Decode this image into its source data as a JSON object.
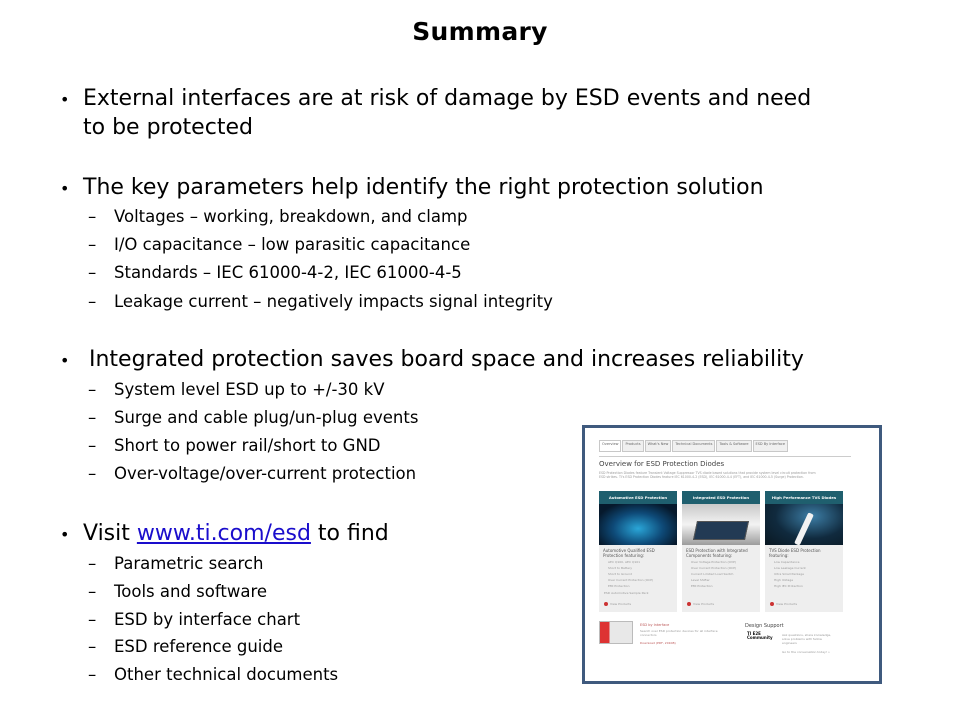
{
  "slide": {
    "title": "Summary",
    "bullets": [
      {
        "lines": [
          "External interfaces are at risk of damage by ESD events and need",
          "to be protected"
        ],
        "sub": []
      },
      {
        "lines": [
          "The key parameters help identify the right protection solution"
        ],
        "sub": [
          "Voltages – working, breakdown, and clamp",
          "I/O capacitance – low parasitic capacitance",
          "Standards – IEC 61000-4-2, IEC 61000-4-5",
          "Leakage current – negatively impacts signal integrity"
        ]
      },
      {
        "lines": [
          "Integrated protection saves board space and increases reliability"
        ],
        "sub": [
          "System level ESD up to +/-30 kV",
          "Surge and cable plug/un-plug events",
          "Short to power rail/short to GND",
          "Over-voltage/over-current protection"
        ]
      },
      {
        "prefix": "Visit ",
        "link": "www.ti.com/esd",
        "suffix": " to find",
        "sub": [
          "Parametric search",
          "Tools and software",
          "ESD by interface chart",
          "ESD reference guide",
          "Other technical documents"
        ]
      }
    ],
    "bullet_glyph": "•",
    "dash_glyph": "–"
  },
  "embedded_screenshot": {
    "tabs": [
      "Overview",
      "Products",
      "What's New",
      "Technical Documents",
      "Tools & Software",
      "ESD By Interface"
    ],
    "title": "Overview for ESD Protection Diodes",
    "description": "ESD Protection Diodes feature Transient Voltage Suppressor TVS diode based solutions that provide system level circuit protection from ESD strikes. TI's ESD Protection Diodes feature IEC 61000-4-2 (ESD), IEC 61000-4-4 (EFT), and IEC 61000-4-5 (Surge) Protection.",
    "cards": [
      {
        "header": "Automotive ESD Protection",
        "title": "Automotive Qualified ESD Protection featuring:",
        "items": [
          "AEC Q100, AEC Q101",
          "Short to Battery",
          "Short to Ground",
          "Over Current Protection (OCP)",
          "EMI Protection"
        ],
        "extra": "ESD Automotive Sample Pack",
        "action": "View Products"
      },
      {
        "header": "Integrated ESD Protection",
        "title": "ESD Protection with Integrated Components featuring:",
        "items": [
          "Over Voltage Protection (OVP)",
          "Over Current Protection (OCP)",
          "Current Limited Load Switch",
          "Level Shifter",
          "EMI Protection"
        ],
        "action": "View Products"
      },
      {
        "header": "High Performance TVS Diodes",
        "title": "TVS Diode ESD Protection featuring:",
        "items": [
          "Low Capacitance",
          "Low Leakage Current",
          "Ultra Small Package",
          "High Voltage",
          "High IEC Protection"
        ],
        "action": "View Products"
      }
    ],
    "esd_by_interface": {
      "title": "ESD by Interface",
      "desc": "Search over ESD protection devices for all interface connectors",
      "download": "Download (PDF, 201KB)"
    },
    "design_support": {
      "title": "Design Support",
      "logo": "TI E2E Community",
      "text": "Ask questions, share knowledge, solve problems with fellow engineers",
      "link": "Go to the conversation today! »"
    }
  }
}
